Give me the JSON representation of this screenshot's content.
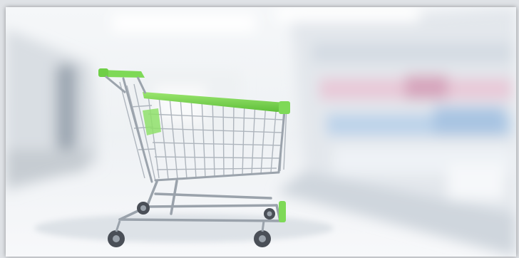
{
  "image": {
    "subject": "shopping-cart",
    "setting": "supermarket-aisle",
    "colors": {
      "frame_border": "#dfe2e6",
      "cart_accent_green": "#7ed957",
      "cart_wire_silver": "#b9bfc6",
      "wheel_dark": "#4a4f57",
      "floor_light": "#f4f6f8",
      "shelf_blur_pink": "#e8c9d8",
      "shelf_blur_blue": "#bcd3ea"
    }
  }
}
